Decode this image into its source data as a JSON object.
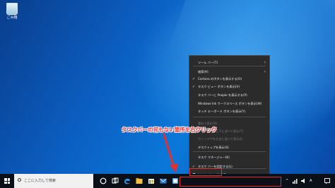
{
  "desktop": {
    "recycle_bin_label": "ごみ箱"
  },
  "context_menu": {
    "items": [
      {
        "label": "ツール バー(T)",
        "checked": false,
        "submenu": true,
        "disabled": false
      },
      {
        "label": "検索(H)",
        "checked": false,
        "submenu": true,
        "disabled": false
      },
      {
        "label": "Cortana のボタンを表示する(O)",
        "checked": true,
        "submenu": false,
        "disabled": false
      },
      {
        "label": "タスク ビュー ボタンを表示(V)",
        "checked": true,
        "submenu": false,
        "disabled": false
      },
      {
        "label": "タスク バーに People を表示する(P)",
        "checked": false,
        "submenu": false,
        "disabled": false
      },
      {
        "label": "Windows Ink ワークスペース ボタンを表示(W)",
        "checked": false,
        "submenu": false,
        "disabled": false
      },
      {
        "label": "タッチ キーボード ボタンを表示(Y)",
        "checked": false,
        "submenu": false,
        "disabled": false
      },
      {
        "label": "重ねて表示(D)",
        "checked": false,
        "submenu": false,
        "disabled": true
      },
      {
        "label": "ウィンドウを上下に並べて表示(T)",
        "checked": false,
        "submenu": false,
        "disabled": true
      },
      {
        "label": "ウィンドウを左右に並べて表示(I)",
        "checked": false,
        "submenu": false,
        "disabled": true
      },
      {
        "label": "デスクトップを表示(S)",
        "checked": false,
        "submenu": false,
        "disabled": false
      },
      {
        "label": "タスク マネージャー(K)",
        "checked": false,
        "submenu": false,
        "disabled": false
      },
      {
        "label": "タスク バーを固定する(L)",
        "checked": true,
        "submenu": false,
        "disabled": false
      },
      {
        "label": "タスク バーの設定(T)",
        "checked": false,
        "submenu": false,
        "disabled": false,
        "icon": "gear-icon"
      }
    ]
  },
  "annotation": {
    "callout_text": "タスクバーの何もない箇所を右クリック",
    "color": "#e23030"
  },
  "taskbar": {
    "search_placeholder": "ここに入力して検索",
    "pinned_icons": [
      "cortana-icon",
      "task-view-icon",
      "edge-icon",
      "explorer-icon",
      "store-icon",
      "mail-icon",
      "app-icon"
    ],
    "tray": {
      "chevron": "^",
      "ime_label": "A"
    }
  },
  "colors": {
    "taskbar": "#0b0f18",
    "menu_bg": "#2b2b2b",
    "desktop_accent": "#0a78d8"
  }
}
